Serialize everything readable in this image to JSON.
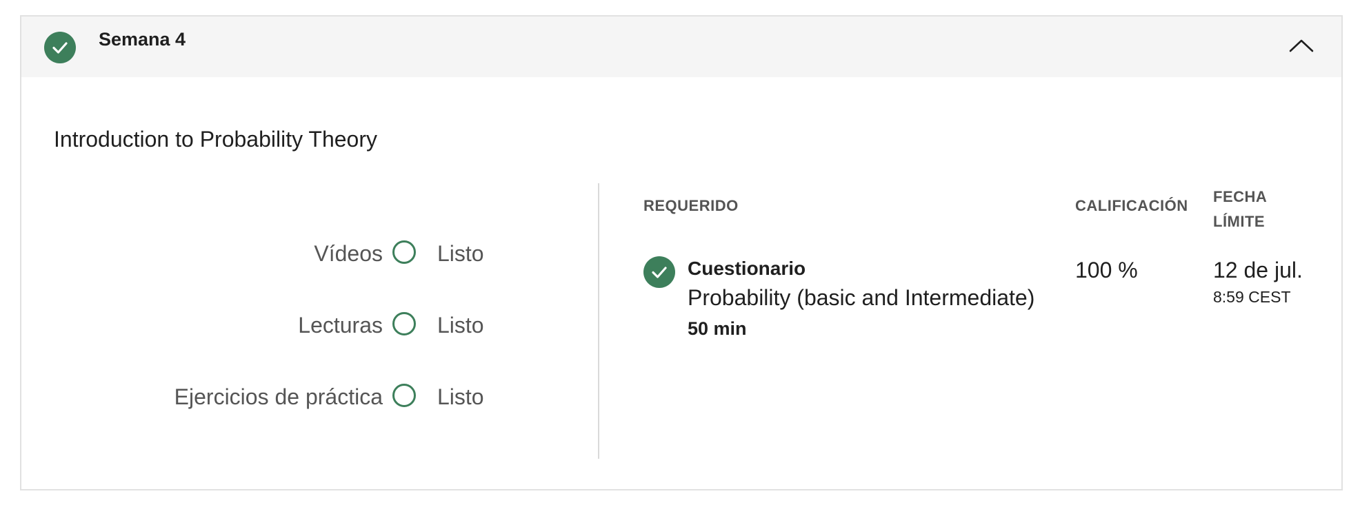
{
  "week": {
    "title": "Semana 4",
    "status_icon": "check-circle-icon",
    "toggle_icon": "chevron-up-icon"
  },
  "module": {
    "title": "Introduction to Probability Theory"
  },
  "progress": [
    {
      "label": "Vídeos",
      "status": "Listo"
    },
    {
      "label": "Lecturas",
      "status": "Listo"
    },
    {
      "label": "Ejercicios de práctica",
      "status": "Listo"
    }
  ],
  "table": {
    "headers": {
      "required": "REQUERIDO",
      "grade": "CALIFICACIÓN",
      "due": "FECHA LÍMITE"
    },
    "items": [
      {
        "type": "Cuestionario",
        "name": "Probability (basic and Intermediate)",
        "duration": "50 min",
        "grade": "100 %",
        "due_date": "12 de jul.",
        "due_time": "8:59 CEST"
      }
    ]
  },
  "colors": {
    "accent_green": "#3d7f5b",
    "header_bg": "#f5f5f5",
    "border": "#e1e1e1"
  }
}
